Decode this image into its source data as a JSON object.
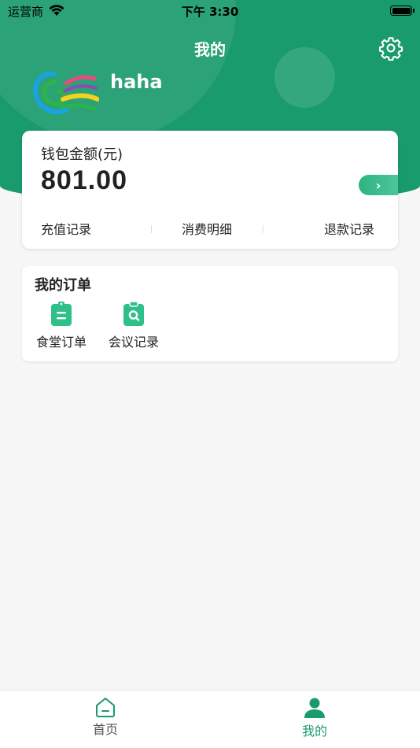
{
  "status_bar": {
    "carrier": "运营商",
    "time": "下午 3:30"
  },
  "header": {
    "title": "我的",
    "username": "haha",
    "icons": {
      "settings": "gear-icon",
      "avatar": "logo-avatar"
    }
  },
  "wallet": {
    "label": "钱包金额(元)",
    "amount": "801.00",
    "arrow_label": "›",
    "links": {
      "recharge": "充值记录",
      "consume": "消费明细",
      "refund": "退款记录"
    }
  },
  "orders": {
    "title": "我的订单",
    "items": [
      {
        "label": "食堂订单",
        "icon": "clipboard-list-icon"
      },
      {
        "label": "会议记录",
        "icon": "clipboard-search-icon"
      }
    ]
  },
  "tabs": [
    {
      "label": "首页",
      "icon": "home-icon",
      "active": false
    },
    {
      "label": "我的",
      "icon": "user-icon",
      "active": true
    }
  ],
  "colors": {
    "brand_green": "#1a9b6c",
    "accent_green": "#2fc08a",
    "background": "#f7f7f7"
  }
}
